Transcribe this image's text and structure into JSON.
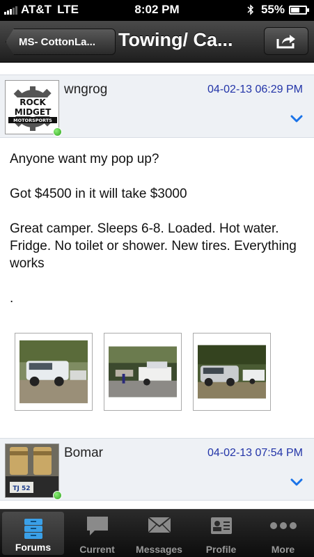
{
  "status_bar": {
    "carrier": "AT&T",
    "network": "LTE",
    "time": "8:02 PM",
    "battery": "55%",
    "battery_level": 0.55
  },
  "nav": {
    "back_label": "MS- CottonLa...",
    "title": "Towing/ Ca..."
  },
  "posts": [
    {
      "username": "wngrog",
      "date": "04-02-13 06:29 PM",
      "avatar_text": [
        "ROCK",
        "MIDGET",
        "MOTORSPORTS"
      ],
      "paragraphs": [
        "Anyone want my pop up?",
        "Got $4500 in it will take $3000",
        "Great camper. Sleeps 6-8. Loaded. Hot water. Fridge. No toilet or shower. New tires. Everything works",
        "."
      ]
    },
    {
      "username": "Bomar",
      "date": "04-02-13 07:54 PM",
      "avatar_plate": "TJ 52"
    }
  ],
  "tabs": [
    {
      "label": "Forums",
      "icon": "forums-icon",
      "active": true
    },
    {
      "label": "Current",
      "icon": "speech-bubble-icon",
      "active": false
    },
    {
      "label": "Messages",
      "icon": "envelope-icon",
      "active": false
    },
    {
      "label": "Profile",
      "icon": "profile-card-icon",
      "active": false
    },
    {
      "label": "More",
      "icon": "more-dots-icon",
      "active": false
    }
  ],
  "colors": {
    "accent": "#2234a8",
    "online": "#2ea21d",
    "chevron": "#1a73e8"
  }
}
